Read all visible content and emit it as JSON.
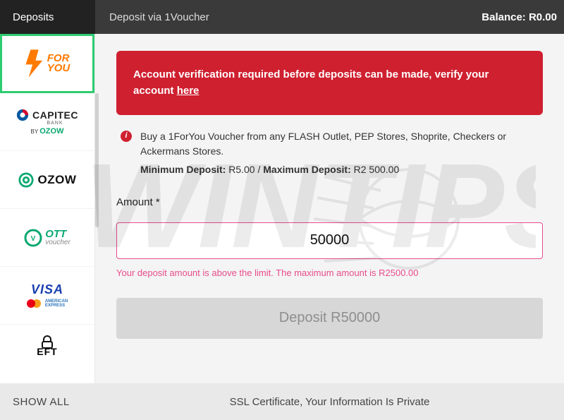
{
  "header": {
    "tab": "Deposits",
    "title": "Deposit via 1Voucher",
    "balance_label": "Balance: R0.00"
  },
  "sidebar": {
    "items": [
      {
        "name": "1ForYou",
        "line1": "FOR",
        "line2": "YOU"
      },
      {
        "name": "Capitec",
        "label": "CAPITEC",
        "sub": "BANK",
        "ozow": "OZOW"
      },
      {
        "name": "Ozow",
        "label": "OZOW"
      },
      {
        "name": "OTT",
        "line1": "OTT",
        "line2": "voucher"
      },
      {
        "name": "Cards",
        "visa": "VISA",
        "amex1": "AMERICAN",
        "amex2": "EXPRESS"
      },
      {
        "name": "EFT",
        "label": "EFT"
      }
    ],
    "show_all": "SHOW ALL"
  },
  "alert": {
    "text": "Account verification required before deposits can be made, verify your account ",
    "link": "here"
  },
  "info": {
    "line1": "Buy a 1ForYou Voucher from any FLASH Outlet, PEP Stores, Shoprite, Checkers or Ackermans Stores.",
    "min_label": "Minimum Deposit:",
    "min_value": "R5.00",
    "sep": " / ",
    "max_label": "Maximum Deposit:",
    "max_value": "R2 500.00"
  },
  "form": {
    "amount_label": "Amount *",
    "amount_value": "50000",
    "error": "Your deposit amount is above the limit. The maximum amount is R2500.00",
    "deposit_btn": "Deposit R50000"
  },
  "footer": {
    "ssl": "SSL Certificate, Your Information Is Private"
  }
}
